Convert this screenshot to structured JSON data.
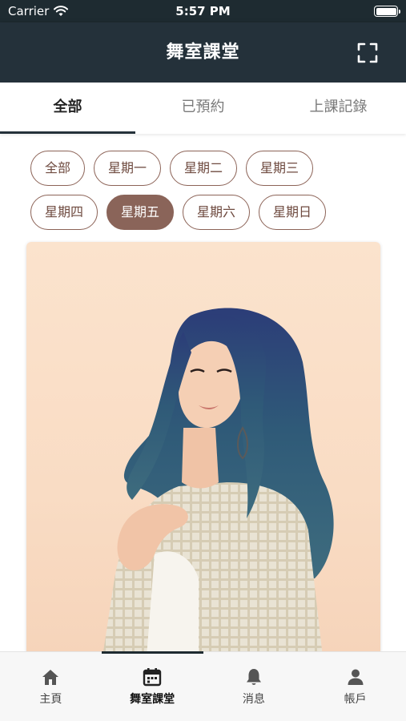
{
  "status_bar": {
    "carrier": "Carrier",
    "time": "5:57 PM",
    "battery_level": 1.0
  },
  "header": {
    "title": "舞室課堂",
    "fullscreen_icon": "fullscreen-icon"
  },
  "tabs": [
    {
      "label": "全部",
      "active": true
    },
    {
      "label": "已預約",
      "active": false
    },
    {
      "label": "上課記錄",
      "active": false
    }
  ],
  "day_filters": {
    "row1": [
      "全部",
      "星期一",
      "星期二",
      "星期三"
    ],
    "row2": [
      "星期四",
      "星期五",
      "星期六",
      "星期日"
    ],
    "selected": "星期五"
  },
  "card": {
    "image": "instructor-photo"
  },
  "bottom_nav": [
    {
      "label": "主頁",
      "icon": "home-icon",
      "active": false
    },
    {
      "label": "舞室課堂",
      "icon": "calendar-icon",
      "active": true
    },
    {
      "label": "消息",
      "icon": "bell-icon",
      "active": false
    },
    {
      "label": "帳戶",
      "icon": "user-icon",
      "active": false
    }
  ],
  "colors": {
    "header_bg": "#24313a",
    "chip_border": "#8c6357",
    "chip_selected": "#8a6459"
  }
}
